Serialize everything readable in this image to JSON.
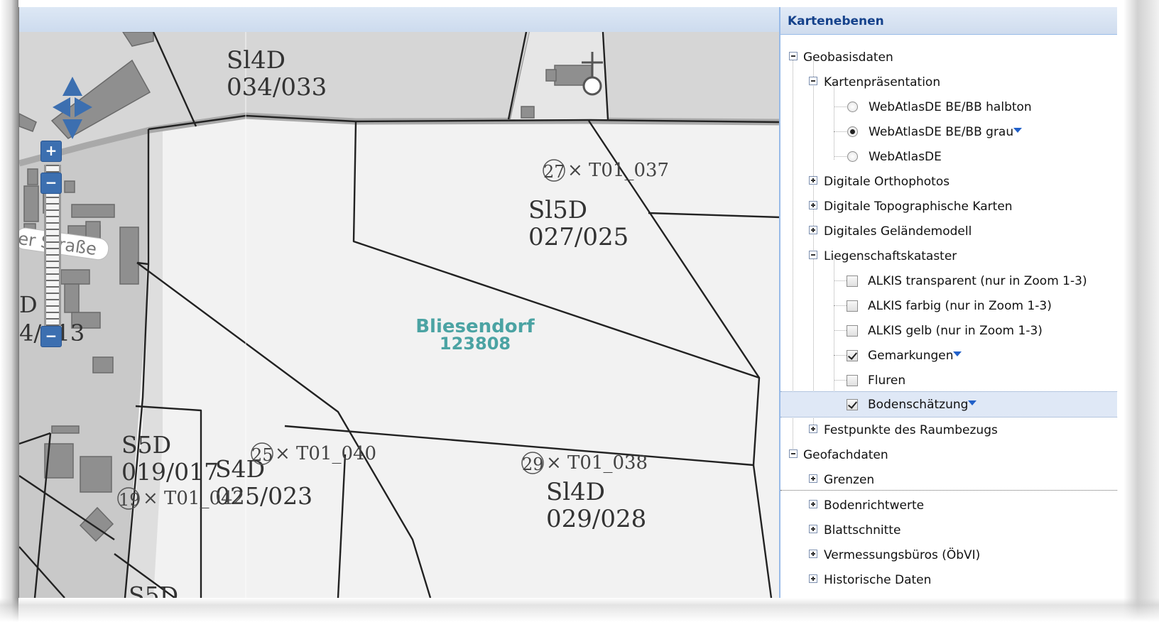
{
  "map": {
    "parcels": [
      {
        "soil": "Sl4D",
        "value": "034/033"
      },
      {
        "soil": "Sl5D",
        "value": "027/025"
      },
      {
        "soil": "S5D",
        "value": "019/017"
      },
      {
        "soil": "S4D",
        "value": "025/023"
      },
      {
        "soil": "Sl4D",
        "value": "029/028"
      },
      {
        "soil": "S5D",
        "value": ""
      }
    ],
    "points": [
      {
        "num": "27",
        "id": "× T01_037"
      },
      {
        "num": "25",
        "id": "× T01_040"
      },
      {
        "num": "29",
        "id": "× T01_038"
      },
      {
        "num": "19",
        "id": "× T01_042"
      }
    ],
    "gemarkung": {
      "name": "Bliesendorf",
      "number": "123808"
    },
    "street_fragment": "er Straße",
    "edge_text_1": "D",
    "edge_text_2": "4/013",
    "colors": {
      "parcel_line": "#222222",
      "gemarkung_label": "#4ba3a3",
      "zoom_button": "#3c6fb0"
    }
  },
  "controls": {
    "zoom_in": "+",
    "zoom_out": "−",
    "icons": [
      "pan-up-icon",
      "pan-left-icon",
      "pan-right-icon",
      "pan-down-icon"
    ]
  },
  "panel": {
    "title": "Kartenebenen",
    "geobasis": "Geobasisdaten",
    "kartenpraesentation": "Kartenpräsentation",
    "webatlas_halbton": "WebAtlasDE BE/BB halbton",
    "webatlas_grau": "WebAtlasDE BE/BB grau",
    "webatlas": "WebAtlasDE",
    "orthophotos": "Digitale Orthophotos",
    "topo": "Digitale Topographische Karten",
    "gelaende": "Digitales Geländemodell",
    "liegenschaft": "Liegenschaftskataster",
    "alkis_transparent": "ALKIS transparent (nur in Zoom 1-3)",
    "alkis_farbig": "ALKIS farbig (nur in Zoom 1-3)",
    "alkis_gelb": "ALKIS gelb (nur in Zoom 1-3)",
    "gemarkungen": "Gemarkungen",
    "fluren": "Fluren",
    "bodenschaetzung": "Bodenschätzung",
    "festpunkte": "Festpunkte des Raumbezugs",
    "geofach": "Geofachdaten",
    "grenzen": "Grenzen",
    "bodenrichtwerte": "Bodenrichtwerte",
    "blattschnitte": "Blattschnitte",
    "vermessung": "Vermessungsbüros (ÖbVI)",
    "historisch": "Historische Daten"
  }
}
